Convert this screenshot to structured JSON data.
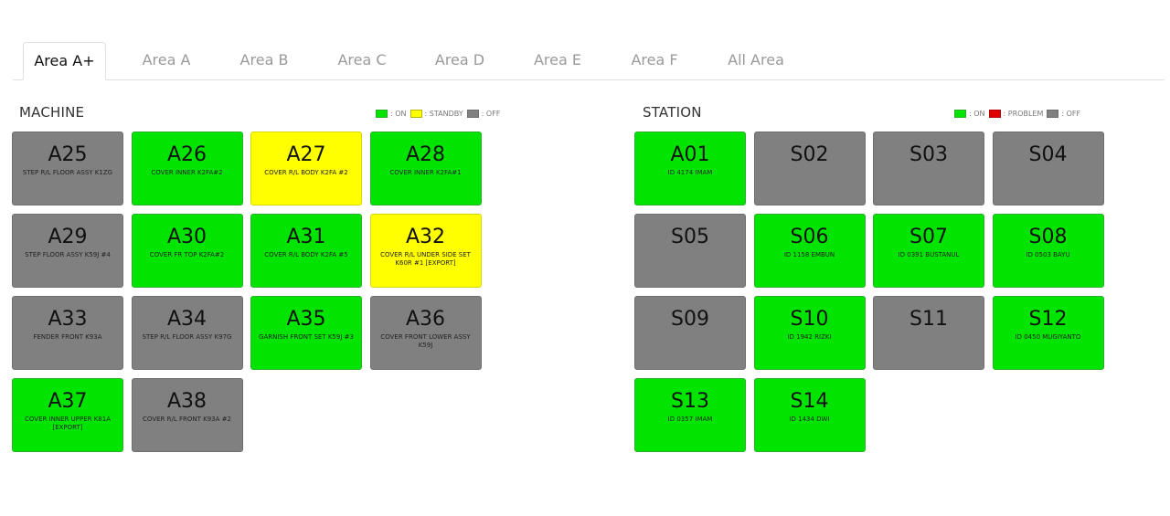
{
  "tabs": [
    {
      "label": "Area A+",
      "active": true
    },
    {
      "label": "Area A",
      "active": false
    },
    {
      "label": "Area B",
      "active": false
    },
    {
      "label": "Area C",
      "active": false
    },
    {
      "label": "Area D",
      "active": false
    },
    {
      "label": "Area E",
      "active": false
    },
    {
      "label": "Area F",
      "active": false
    },
    {
      "label": "All Area",
      "active": false
    }
  ],
  "colors": {
    "on": "#00e400",
    "off": "#808080",
    "standby": "#ffff00",
    "problem": "#e00000"
  },
  "machine": {
    "title": "MACHINE",
    "legend": [
      {
        "status": "on",
        "label": ": ON"
      },
      {
        "status": "standby",
        "label": ": STANDBY"
      },
      {
        "status": "off",
        "label": ": OFF"
      }
    ],
    "tiles": [
      {
        "code": "A25",
        "desc": "STEP R/L FLOOR ASSY K1ZG",
        "status": "off"
      },
      {
        "code": "A26",
        "desc": "COVER INNER K2FA#2",
        "status": "on"
      },
      {
        "code": "A27",
        "desc": "COVER R/L BODY K2FA #2",
        "status": "standby"
      },
      {
        "code": "A28",
        "desc": "COVER INNER K2FA#1",
        "status": "on"
      },
      {
        "code": "A29",
        "desc": "STEP FLOOR ASSY K59J #4",
        "status": "off"
      },
      {
        "code": "A30",
        "desc": "COVER FR TOP K2FA#2",
        "status": "on"
      },
      {
        "code": "A31",
        "desc": "COVER R/L BODY K2FA #5",
        "status": "on"
      },
      {
        "code": "A32",
        "desc": "COVER R/L UNDER SIDE SET K60R #1 [EXPORT]",
        "status": "standby"
      },
      {
        "code": "A33",
        "desc": "FENDER FRONT K93A",
        "status": "off"
      },
      {
        "code": "A34",
        "desc": "STEP R/L FLOOR ASSY K97G",
        "status": "off"
      },
      {
        "code": "A35",
        "desc": "GARNISH FRONT SET K59J #3",
        "status": "on"
      },
      {
        "code": "A36",
        "desc": "COVER FRONT LOWER ASSY K59J",
        "status": "off"
      },
      {
        "code": "A37",
        "desc": "COVER INNER UPPER K81A [EXPORT]",
        "status": "on"
      },
      {
        "code": "A38",
        "desc": "COVER R/L FRONT K93A #2",
        "status": "off"
      }
    ]
  },
  "station": {
    "title": "STATION",
    "legend": [
      {
        "status": "on",
        "label": ": ON"
      },
      {
        "status": "problem",
        "label": ": PROBLEM"
      },
      {
        "status": "off",
        "label": ": OFF"
      }
    ],
    "tiles": [
      {
        "code": "A01",
        "desc": "ID 4174 IMAM",
        "status": "on"
      },
      {
        "code": "S02",
        "desc": "",
        "status": "off"
      },
      {
        "code": "S03",
        "desc": "",
        "status": "off"
      },
      {
        "code": "S04",
        "desc": "",
        "status": "off"
      },
      {
        "code": "S05",
        "desc": "",
        "status": "off"
      },
      {
        "code": "S06",
        "desc": "ID 1158 EMBUN",
        "status": "on"
      },
      {
        "code": "S07",
        "desc": "ID 0391 BUSTANUL",
        "status": "on"
      },
      {
        "code": "S08",
        "desc": "ID 0503 BAYU",
        "status": "on"
      },
      {
        "code": "S09",
        "desc": "",
        "status": "off"
      },
      {
        "code": "S10",
        "desc": "ID 1942 RIZKI",
        "status": "on"
      },
      {
        "code": "S11",
        "desc": "",
        "status": "off"
      },
      {
        "code": "S12",
        "desc": "ID 0450 MUGIYANTO",
        "status": "on"
      },
      {
        "code": "S13",
        "desc": "ID 0357 IMAM",
        "status": "on"
      },
      {
        "code": "S14",
        "desc": "ID 1434 DWI",
        "status": "on"
      }
    ]
  }
}
